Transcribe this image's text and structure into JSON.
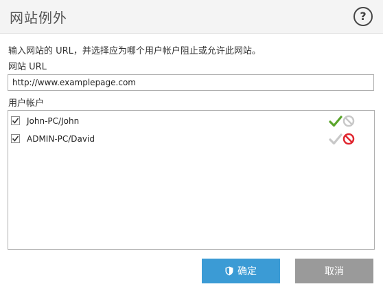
{
  "dialog": {
    "title": "网站例外",
    "help_icon": "help-circle-icon",
    "help_glyph": "?"
  },
  "description": "输入网站的 URL，并选择应为哪个用户帐户阻止或允许此网站。",
  "url_field": {
    "label": "网站 URL",
    "value": "http://www.examplepage.com"
  },
  "user_accounts": {
    "label": "用户帐户",
    "rows": [
      {
        "name": "John-PC/John",
        "checked": true,
        "permission": "allow"
      },
      {
        "name": "ADMIN-PC/David",
        "checked": true,
        "permission": "block"
      }
    ]
  },
  "buttons": {
    "ok_label": "确定",
    "cancel_label": "取消"
  },
  "colors": {
    "allow_active": "#5aa52b",
    "block_active": "#e0262f",
    "inactive": "#c8c8c8",
    "primary": "#3b9bd5",
    "secondary": "#9a9a9a"
  }
}
